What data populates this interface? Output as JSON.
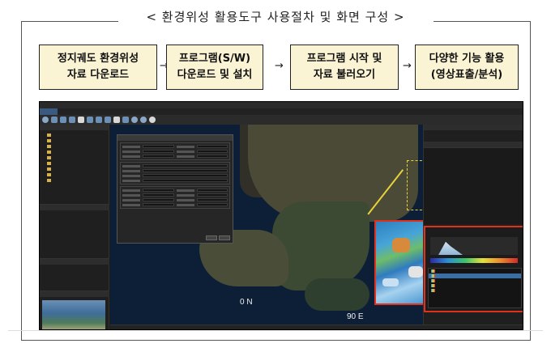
{
  "page": {
    "title": "< 환경위성 활용도구 사용절차 및 화면 구성 >"
  },
  "steps": [
    {
      "line1": "정지궤도 환경위성",
      "line2": "자료 다운로드"
    },
    {
      "line1": "프로그램(S/W)",
      "line2": "다운로드 및 설치"
    },
    {
      "line1": "프로그램 시작 및",
      "line2": "자료 불러오기"
    },
    {
      "line1": "다양한 기능 활용",
      "line2": "(영상표출/분석)"
    }
  ],
  "arrows": [
    "→",
    "→",
    "→"
  ],
  "app": {
    "map": {
      "lat_label": "0 N",
      "lon_label": "90 E"
    }
  },
  "colors": {
    "step_fill": "#fbf4d4",
    "highlight_red": "#e0301e",
    "highlight_yellow": "#e8d23a",
    "app_bg": "#1b1b1b"
  },
  "icons": [
    "folder-icon",
    "toolbar-icon",
    "globe-icon"
  ]
}
